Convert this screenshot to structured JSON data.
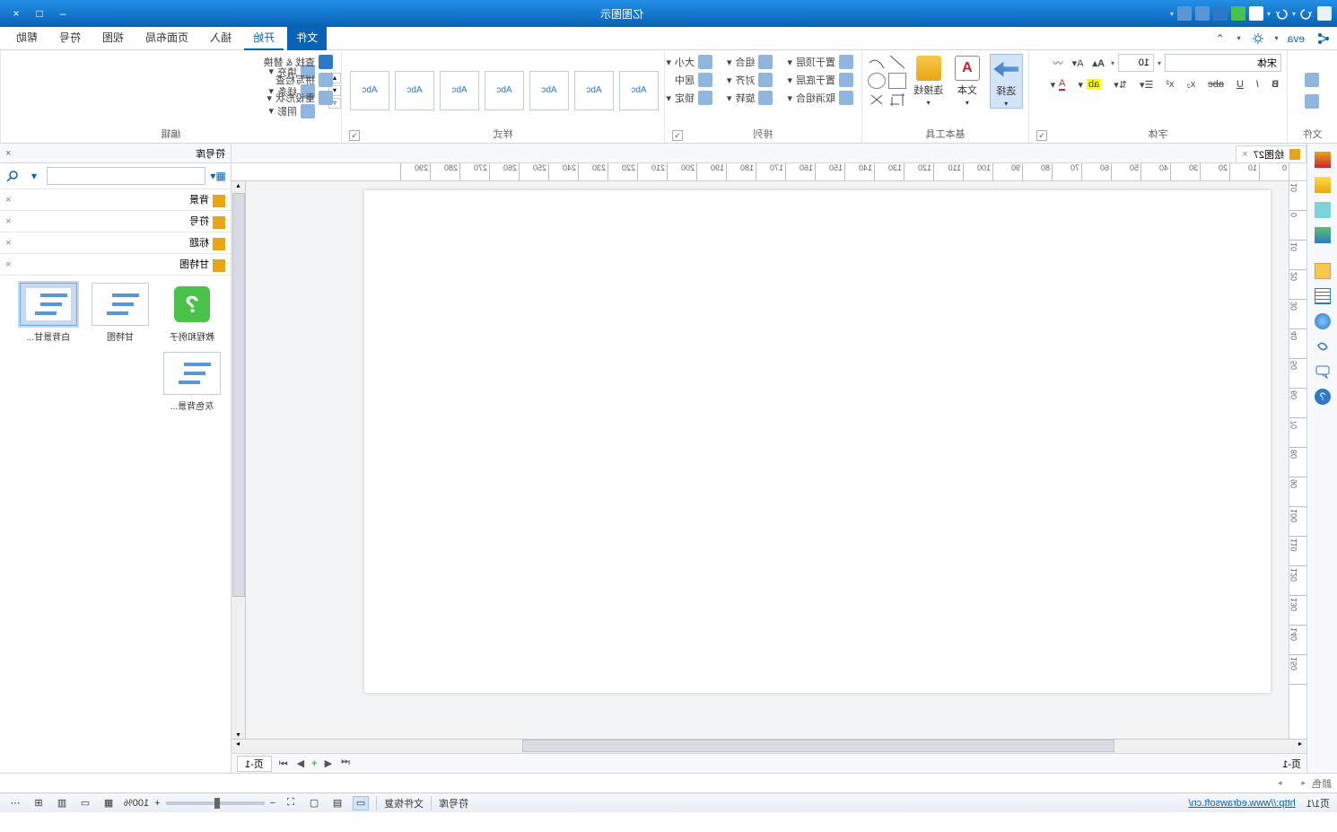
{
  "app_title": "亿图图示",
  "titlebar_icons": [
    "logo",
    "undo",
    "redo",
    "new",
    "cloud",
    "save",
    "print",
    "page"
  ],
  "window_controls": {
    "min": "–",
    "max": "□",
    "close": "×"
  },
  "quick": {
    "share": "",
    "settings": "",
    "cloud": "",
    "user": "eva"
  },
  "ribbon_tabs": [
    "文件",
    "开始",
    "插入",
    "页面布局",
    "视图",
    "符号",
    "帮助"
  ],
  "active_tab": "开始",
  "groups": {
    "wenjian": "文件",
    "ziti": "字体",
    "gongju": "基本工具",
    "paili": "排列",
    "yangshi": "样式",
    "bianji": "编辑"
  },
  "font": {
    "name": "宋体",
    "size": "10"
  },
  "font_btns": {
    "bold": "B",
    "italic": "I",
    "underline": "U",
    "strike": "abc",
    "sub": "x₂",
    "sup": "x²"
  },
  "tools": {
    "select": "选择",
    "text": "文本",
    "link": "连接线"
  },
  "arrange": {
    "top": "置于顶层",
    "bottom": "置于底层",
    "ungroup": "取消组合",
    "group": "组合",
    "align": "对齐",
    "rotate": "旋转",
    "lock": "锁定",
    "center": "居中",
    "size": "大小"
  },
  "style_label": "Abc",
  "edit": {
    "fill": "填充",
    "line": "线条",
    "shadow": "阴影",
    "find": "查找 & 替换",
    "check": "拼写检查",
    "layout": "重设形状"
  },
  "doc_tab": {
    "name": "绘图27",
    "close": "×"
  },
  "ruler_h_vals": [
    "0",
    "10",
    "20",
    "30",
    "40",
    "50",
    "60",
    "70",
    "80",
    "90",
    "100",
    "110",
    "120",
    "130",
    "140",
    "150",
    "160",
    "170",
    "180",
    "190",
    "200",
    "210",
    "220",
    "230",
    "240",
    "250",
    "260",
    "270",
    "280",
    "290"
  ],
  "ruler_v_vals": [
    "10",
    "0",
    "10",
    "20",
    "30",
    "40",
    "50",
    "60",
    "70",
    "80",
    "90",
    "100",
    "110",
    "120",
    "130",
    "140",
    "150"
  ],
  "rpanel": {
    "title": "符号库",
    "close": "×",
    "search_ph": "",
    "cats": [
      "背景",
      "符号",
      "标题",
      "甘特图"
    ],
    "thumbs": [
      {
        "label": "教程和例子",
        "type": "help"
      },
      {
        "label": "甘特图",
        "type": "gantt"
      },
      {
        "label": "白背景甘...",
        "type": "gantt",
        "sel": true
      },
      {
        "label": "灰色背景...",
        "type": "gantt"
      }
    ]
  },
  "pagetabs": {
    "label": "页-1",
    "nav": [
      "⏮",
      "◀",
      "▶",
      "⏭"
    ],
    "plus": "+",
    "current": "页-1"
  },
  "colorbar_label": "颜色",
  "grays": [
    "#ffffff",
    "#f2f2f2",
    "#d9d9d9",
    "#bfbfbf",
    "#a6a6a6",
    "#8c8c8c",
    "#737373",
    "#595959",
    "#404040",
    "#262626",
    "#000000"
  ],
  "colors": [
    "#5b3a29",
    "#7b4b2a",
    "#a0522d",
    "#cd853f",
    "#d2b48c",
    "#8b0000",
    "#b22222",
    "#dc143c",
    "#ff0000",
    "#ff4500",
    "#ff6347",
    "#ff7f50",
    "#ffa500",
    "#ffd700",
    "#ffff00",
    "#adff2f",
    "#7fff00",
    "#00ff00",
    "#32cd32",
    "#228b22",
    "#2e8b57",
    "#008080",
    "#20b2aa",
    "#00ced1",
    "#00bfff",
    "#1e90ff",
    "#4169e1",
    "#0000ff",
    "#0000cd",
    "#4b0082",
    "#6a0dad",
    "#8a2be2",
    "#9932cc",
    "#ba55d3",
    "#da70d6",
    "#ee82ee",
    "#ff00ff",
    "#ff1493",
    "#ff69b4",
    "#ffb6c1"
  ],
  "extra_reds": [
    "#e06666",
    "#cc4444",
    "#b22222",
    "#8b1a1a",
    "#6b0f0f"
  ],
  "status": {
    "page": "页1/1",
    "url": "http://www.edrawsoft.cn/",
    "symlib": "符号库",
    "filerec": "文件恢复",
    "zoom": "100%"
  }
}
